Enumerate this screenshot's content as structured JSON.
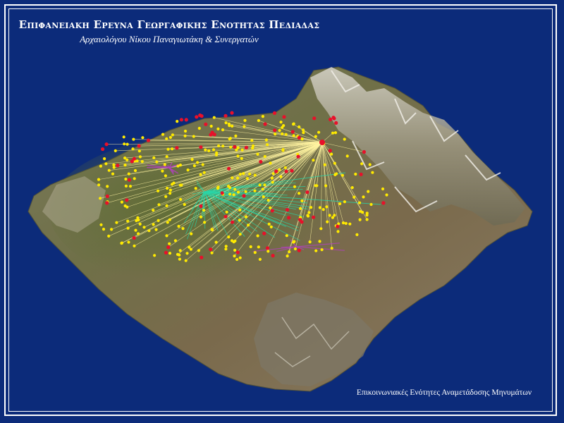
{
  "header": {
    "title": "Επιφανειακη Ερευνα Γεωργαφικης Ενοτητας Πεδιαδας",
    "subtitle": "Αρχαιολόγου Νίκου Παναγιωτάκη & Συνεργατών"
  },
  "footer": {
    "caption": "Επικοινωνιακές Ενότητες Αναμετάδοσης Μηνυμάτων"
  },
  "colors": {
    "background": "#0c2b7a",
    "site_yellow": "#ffea00",
    "site_red": "#e8102a",
    "line_yellow": "#fff3a0",
    "line_cyan": "#29d6a8",
    "line_purple": "#b43fc2"
  }
}
